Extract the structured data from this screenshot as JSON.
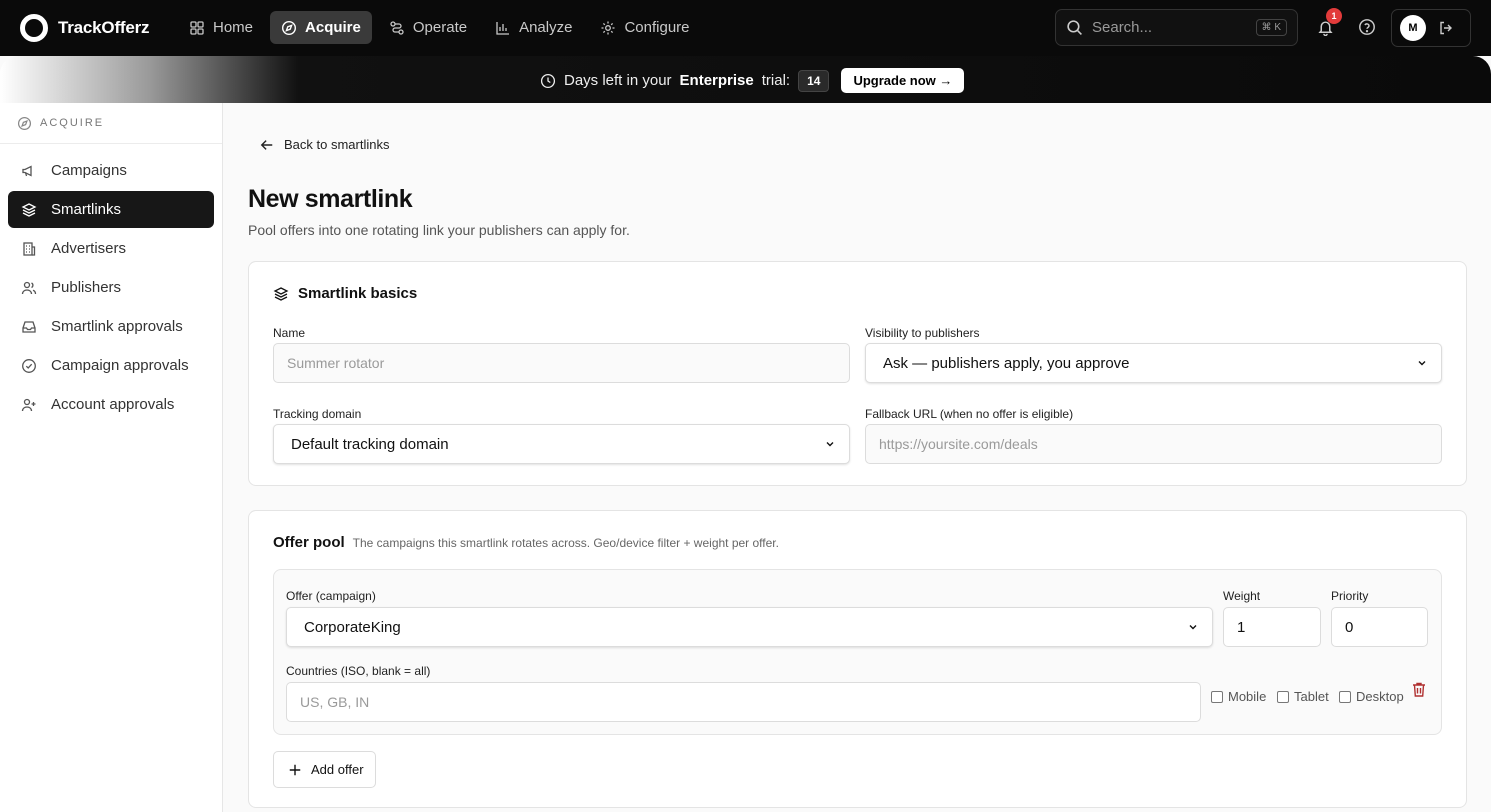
{
  "app": {
    "name": "TrackOfferz"
  },
  "nav": {
    "items": [
      {
        "label": "Home",
        "icon": "grid-icon"
      },
      {
        "label": "Acquire",
        "icon": "compass-icon",
        "active": true
      },
      {
        "label": "Operate",
        "icon": "route-icon"
      },
      {
        "label": "Analyze",
        "icon": "bar-chart-icon"
      },
      {
        "label": "Configure",
        "icon": "gear-icon"
      }
    ],
    "search_placeholder": "Search...",
    "search_shortcut": "⌘ K",
    "notifications_count": "1",
    "user_initial": "M"
  },
  "banner": {
    "prefix": "Days left in your",
    "tier": "Enterprise",
    "suffix": "trial:",
    "days": "14",
    "upgrade_label": "Upgrade now →"
  },
  "sidebar": {
    "section": "ACQUIRE",
    "items": [
      {
        "label": "Campaigns"
      },
      {
        "label": "Smartlinks",
        "active": true
      },
      {
        "label": "Advertisers"
      },
      {
        "label": "Publishers"
      },
      {
        "label": "Smartlink approvals"
      },
      {
        "label": "Campaign approvals"
      },
      {
        "label": "Account approvals"
      }
    ]
  },
  "page": {
    "back_label": "Back to smartlinks",
    "title": "New smartlink",
    "subtitle": "Pool offers into one rotating link your publishers can apply for."
  },
  "basics": {
    "title": "Smartlink basics",
    "name_label": "Name",
    "name_placeholder": "Summer rotator",
    "visibility_label": "Visibility to publishers",
    "visibility_value": "Ask — publishers apply, you approve",
    "tracking_label": "Tracking domain",
    "tracking_value": "Default tracking domain",
    "fallback_label": "Fallback URL (when no offer is eligible)",
    "fallback_placeholder": "https://yoursite.com/deals"
  },
  "pool": {
    "title": "Offer pool",
    "description": "The campaigns this smartlink rotates across. Geo/device filter + weight per offer.",
    "offer": {
      "offer_label": "Offer (campaign)",
      "offer_value": "CorporateKing",
      "weight_label": "Weight",
      "weight_value": "1",
      "priority_label": "Priority",
      "priority_value": "0",
      "countries_label": "Countries (ISO, blank = all)",
      "countries_placeholder": "US, GB, IN",
      "devices": [
        "Mobile",
        "Tablet",
        "Desktop"
      ]
    },
    "add_label": "Add offer"
  },
  "colors": {
    "nav_bg": "#0a0a0a",
    "active_side": "#171717",
    "danger": "#b03030",
    "badge": "#e23b3b"
  }
}
